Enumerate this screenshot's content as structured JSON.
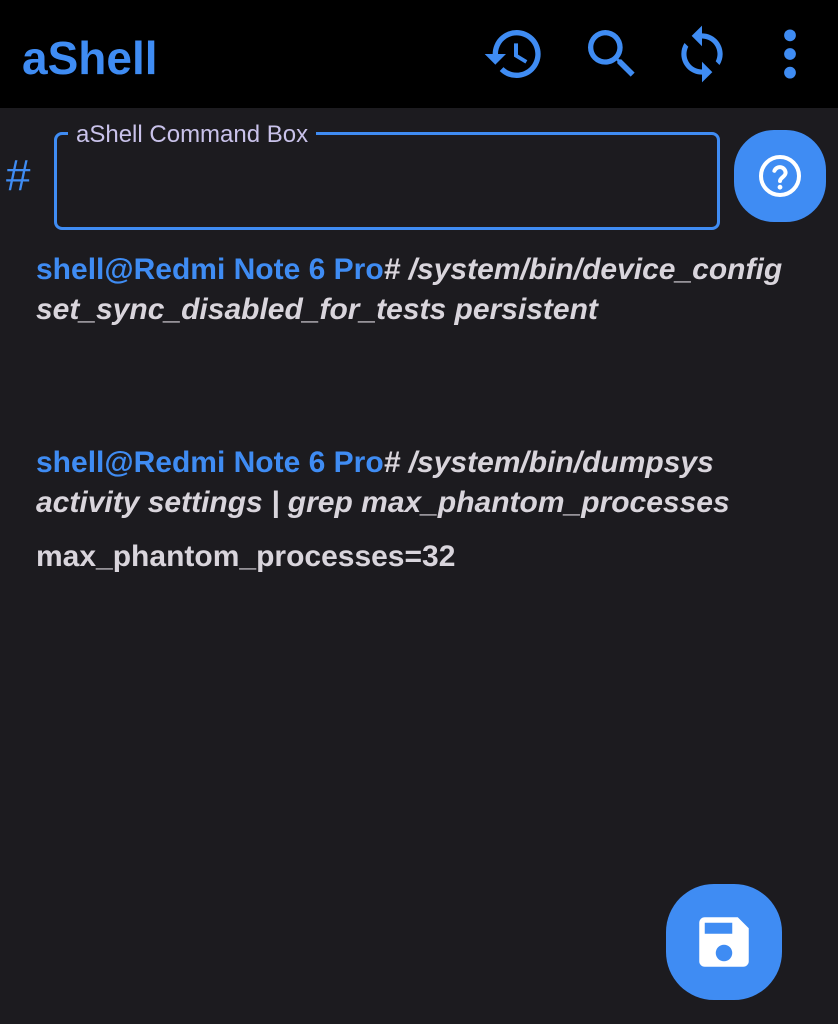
{
  "app_bar": {
    "title": "aShell",
    "icons": [
      "history-icon",
      "search-icon",
      "refresh-icon",
      "more-vert-icon"
    ],
    "accent_color": "#3f8cf3",
    "background": "#000000"
  },
  "command_box": {
    "prompt_symbol": "#",
    "label": "aShell Command Box",
    "value": "",
    "help_icon": "help-icon"
  },
  "output": {
    "entries": [
      {
        "prompt": "shell@Redmi Note 6 Pro",
        "hash": "#",
        "command": " /system/bin/device_config set_sync_disabled_for_tests persistent"
      },
      {
        "prompt": "shell@Redmi Note 6 Pro",
        "hash": "#",
        "command": " /system/bin/dumpsys activity settings | grep max_phantom_processes"
      }
    ],
    "result": "max_phantom_processes=32"
  },
  "save_button": {
    "icon": "save-icon"
  },
  "colors": {
    "background": "#1c1b1f",
    "text": "#d9d5dc",
    "label": "#c9c2ea"
  }
}
